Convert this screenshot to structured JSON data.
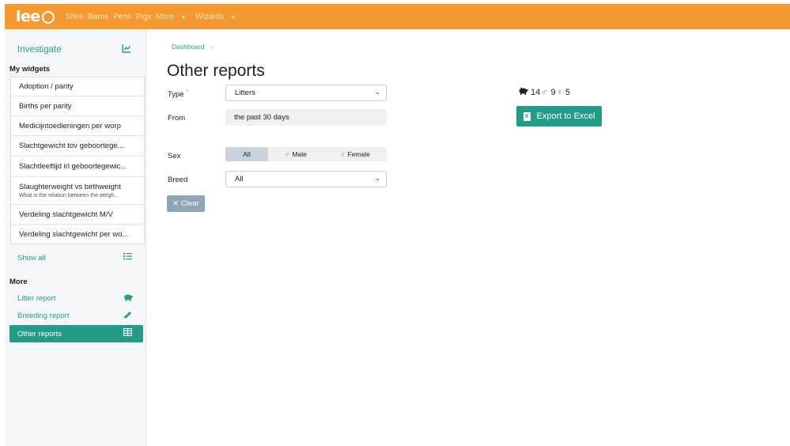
{
  "brand": {
    "logo_text": "lee"
  },
  "nav": {
    "items": [
      "Sites",
      "Barns",
      "Pens",
      "Pigs"
    ],
    "more": "More",
    "wizards": "Wizards"
  },
  "sidebar": {
    "heading": "Investigate",
    "my_widgets_title": "My widgets",
    "widgets": [
      {
        "label": "Adoption / parity"
      },
      {
        "label": "Births per parity"
      },
      {
        "label": "Medicijntoedieningen per worp"
      },
      {
        "label": "Slachtgewicht tov geboortege..."
      },
      {
        "label": "Slachtleeftijd irl geboortegewic..."
      },
      {
        "label": "Slaughterweight vs birthweight",
        "sub": "What is the relation between the weigh..."
      },
      {
        "label": "Verdeling slachtgewicht M/V"
      },
      {
        "label": "Verdeling slachtgewicht per wo..."
      }
    ],
    "show_all": "Show all",
    "more_title": "More",
    "more_items": [
      {
        "label": "Litter report",
        "icon": "pig-icon"
      },
      {
        "label": "Breeding report",
        "icon": "syringe-icon"
      },
      {
        "label": "Other reports",
        "icon": "table-icon",
        "active": true
      }
    ]
  },
  "breadcrumb": {
    "dashboard": "Dashboard"
  },
  "page_title": "Other reports",
  "filters": {
    "type_label": "Type",
    "type_required": "*",
    "type_value": "Litters",
    "from_label": "From",
    "from_value": "the past 30 days",
    "sex_label": "Sex",
    "sex_options": {
      "all": "All",
      "male": "Male",
      "female": "Female"
    },
    "sex_selected": "All",
    "breed_label": "Breed",
    "breed_value": "All",
    "clear_label": "Clear"
  },
  "summary": {
    "total": "14",
    "male_count": "9",
    "female_count": "5"
  },
  "export": {
    "label": "Export to Excel"
  },
  "colors": {
    "topbar": "#f59a32",
    "accent": "#249b86",
    "male": "#3578c8",
    "female": "#e0324a"
  }
}
